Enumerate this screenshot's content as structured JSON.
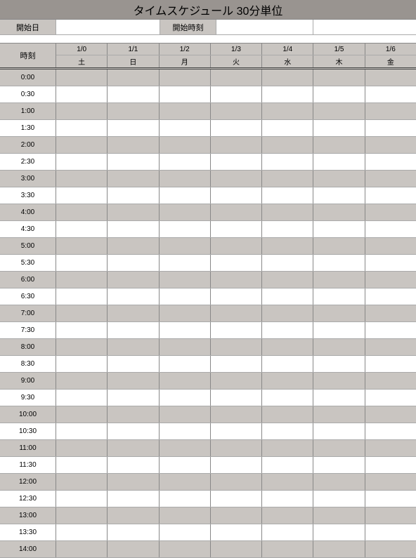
{
  "title": "タイムスケジュール 30分単位",
  "inputs": {
    "start_date_label": "開始日",
    "start_time_label": "開始時刻",
    "start_date_value": "",
    "start_time_value": ""
  },
  "header": {
    "time_label": "時刻",
    "dates": [
      "1/0",
      "1/1",
      "1/2",
      "1/3",
      "1/4",
      "1/5",
      "1/6"
    ],
    "dows": [
      "土",
      "日",
      "月",
      "火",
      "水",
      "木",
      "金"
    ]
  },
  "times": [
    "0:00",
    "0:30",
    "1:00",
    "1:30",
    "2:00",
    "2:30",
    "3:00",
    "3:30",
    "4:00",
    "4:30",
    "5:00",
    "5:30",
    "6:00",
    "6:30",
    "7:00",
    "7:30",
    "8:00",
    "8:30",
    "9:00",
    "9:30",
    "10:00",
    "10:30",
    "11:00",
    "11:30",
    "12:00",
    "12:30",
    "13:00",
    "13:30",
    "14:00"
  ]
}
